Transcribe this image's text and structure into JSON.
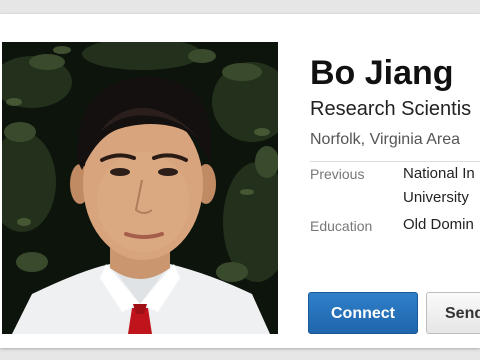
{
  "profile": {
    "name": "Bo Jiang",
    "headline": "Research Scientis",
    "location": "Norfolk, Virginia Area",
    "previous_label": "Previous",
    "previous_values": [
      "National In",
      "University"
    ],
    "education_label": "Education",
    "education_value": "Old Domin"
  },
  "actions": {
    "connect_label": "Connect",
    "send_label": "Send"
  },
  "colors": {
    "connect_blue": "#2473bd",
    "tie_red": "#c0141c"
  },
  "icons": [
    "profile-photo"
  ]
}
